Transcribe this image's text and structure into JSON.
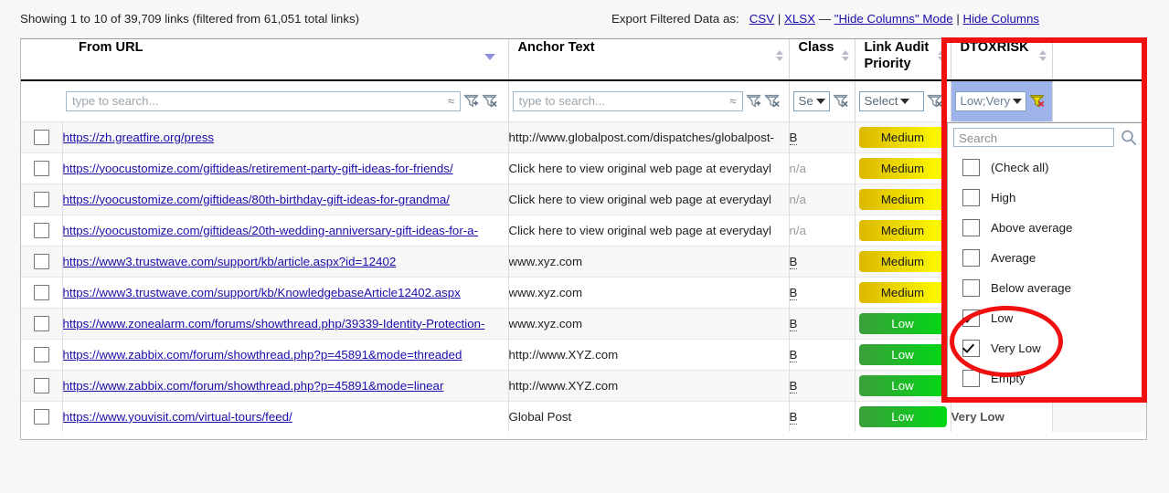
{
  "topbar": {
    "showing_text": "Showing 1 to 10 of 39,709 links (filtered from 61,051 total links)",
    "export_label": "Export Filtered Data as:",
    "export_csv": "CSV",
    "export_xlsx": "XLSX",
    "hide_columns_mode": "\"Hide Columns\" Mode",
    "hide_columns": "Hide Columns",
    "pipe": "|",
    "dash": "—"
  },
  "table": {
    "columns": [
      {
        "key": "checkbox",
        "label": ""
      },
      {
        "key": "from_url",
        "label": "From URL"
      },
      {
        "key": "anchor_text",
        "label": "Anchor Text"
      },
      {
        "key": "class",
        "label": "Class"
      },
      {
        "key": "link_audit_priority",
        "label": "Link Audit Priority"
      },
      {
        "key": "dtoxrisk",
        "label": "DTOXRISK"
      },
      {
        "key": "spacer",
        "label": ""
      }
    ],
    "filters": {
      "from_url_placeholder": "type to search...",
      "anchor_placeholder": "type to search...",
      "class_value": "Se",
      "priority_value": "Select",
      "dtoxrisk_value": "Low;Very",
      "approx_symbol": "≈"
    },
    "rows": [
      {
        "url": "https://zh.greatfire.org/press",
        "anchor": "http://www.globalpost.com/dispatches/globalpost-",
        "class": "B",
        "priority": "Medium",
        "priority_level": "medium",
        "dtoxrisk": ""
      },
      {
        "url": "https://yoocustomize.com/giftideas/retirement-party-gift-ideas-for-friends/",
        "anchor": "Click here to view original web page at everydayl",
        "class": "n/a",
        "priority": "Medium",
        "priority_level": "medium",
        "dtoxrisk": ""
      },
      {
        "url": "https://yoocustomize.com/giftideas/80th-birthday-gift-ideas-for-grandma/",
        "anchor": "Click here to view original web page at everydayl",
        "class": "n/a",
        "priority": "Medium",
        "priority_level": "medium",
        "dtoxrisk": ""
      },
      {
        "url": "https://yoocustomize.com/giftideas/20th-wedding-anniversary-gift-ideas-for-a-",
        "anchor": "Click here to view original web page at everydayl",
        "class": "n/a",
        "priority": "Medium",
        "priority_level": "medium",
        "dtoxrisk": ""
      },
      {
        "url": "https://www3.trustwave.com/support/kb/article.aspx?id=12402",
        "anchor": "www.xyz.com",
        "class": "B",
        "priority": "Medium",
        "priority_level": "medium",
        "dtoxrisk": ""
      },
      {
        "url": "https://www3.trustwave.com/support/kb/KnowledgebaseArticle12402.aspx",
        "anchor": "www.xyz.com",
        "class": "B",
        "priority": "Medium",
        "priority_level": "medium",
        "dtoxrisk": ""
      },
      {
        "url": "https://www.zonealarm.com/forums/showthread.php/39339-Identity-Protection-",
        "anchor": "www.xyz.com",
        "class": "B",
        "priority": "Low",
        "priority_level": "low",
        "dtoxrisk": ""
      },
      {
        "url": "https://www.zabbix.com/forum/showthread.php?p=45891&mode=threaded",
        "anchor": "http://www.XYZ.com",
        "class": "B",
        "priority": "Low",
        "priority_level": "low",
        "dtoxrisk": ""
      },
      {
        "url": "https://www.zabbix.com/forum/showthread.php?p=45891&mode=linear",
        "anchor": "http://www.XYZ.com",
        "class": "B",
        "priority": "Low",
        "priority_level": "low",
        "dtoxrisk": ""
      },
      {
        "url": "https://www.youvisit.com/virtual-tours/feed/",
        "anchor": "Global Post",
        "class": "B",
        "priority": "Low",
        "priority_level": "low",
        "dtoxrisk": "Very Low"
      }
    ]
  },
  "dropdown": {
    "search_placeholder": "Search",
    "items": [
      {
        "label": "(Check all)",
        "checked": false
      },
      {
        "label": "High",
        "checked": false
      },
      {
        "label": "Above average",
        "checked": false
      },
      {
        "label": "Average",
        "checked": false
      },
      {
        "label": "Below average",
        "checked": false
      },
      {
        "label": "Low",
        "checked": true
      },
      {
        "label": "Very Low",
        "checked": true
      },
      {
        "label": "Empty",
        "checked": false
      }
    ]
  },
  "colors": {
    "annotation": "#f01010",
    "link": "#1a0dab",
    "medium_badge_start": "#dcb800",
    "medium_badge_end": "#ffff00",
    "low_badge_start": "#3c9e3c",
    "low_badge_end": "#00d914",
    "filter_highlight": "#9db3ea"
  }
}
